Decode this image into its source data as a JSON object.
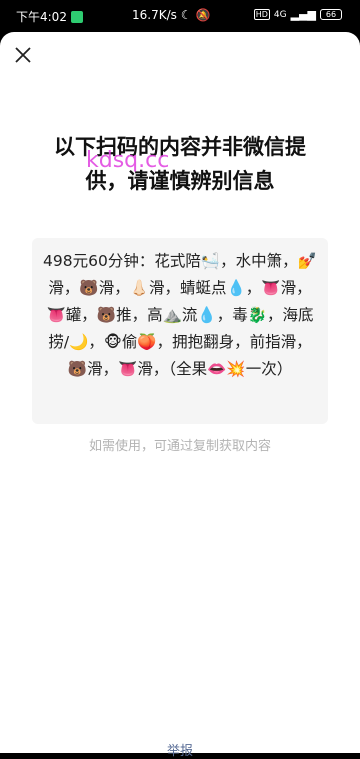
{
  "status_bar": {
    "time": "下午4:02",
    "speed": "16.7K/s",
    "network": "4G",
    "battery": "66"
  },
  "sheet": {
    "close_icon": "close-icon",
    "headline": "以下扫码的内容并非微信提\n供，请谨慎辨别信息",
    "watermark": "kdsq.cc",
    "content": "498元60分钟：花式陪🛀，水中箫，💅滑，🐻滑，👃🏻滑，蜻蜓点💧，👅滑，👅罐，🐻推，高⛰️流💧，毒🐉，海底捞/🌙，🐵偷🍑，拥抱翻身，前指滑，🐻滑，👅滑，（全果👄💥一次）",
    "hint": "如需使用，可通过复制获取内容",
    "report_link": "举报"
  }
}
